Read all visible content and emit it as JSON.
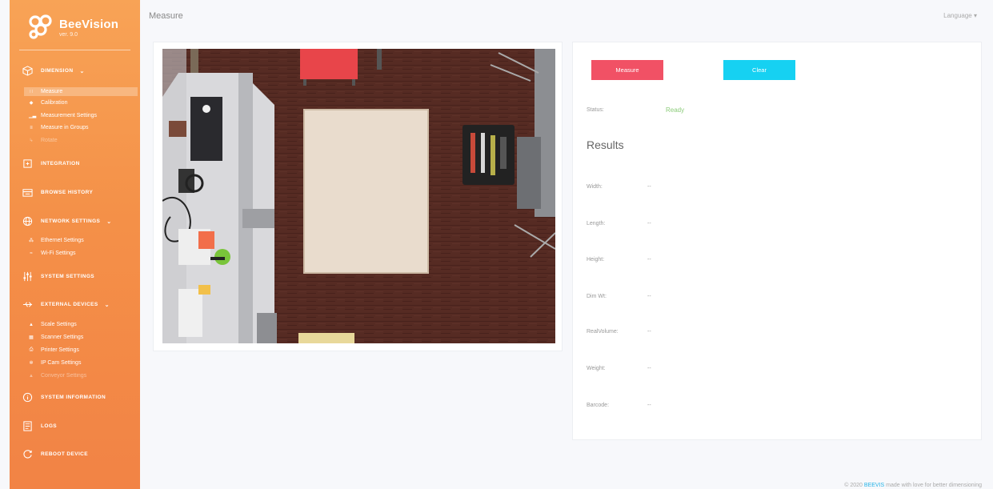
{
  "app": {
    "name": "BeeVision",
    "version": "ver. 9.0"
  },
  "sidebar": {
    "sections": [
      {
        "label": "Dimension",
        "icon": "cube-icon",
        "expanded": true,
        "items": [
          {
            "label": "Measure",
            "icon": "grid-icon",
            "active": true
          },
          {
            "label": "Calibration",
            "icon": "diamond-icon"
          },
          {
            "label": "Measurement Settings",
            "icon": "bar-chart-icon"
          },
          {
            "label": "Measure in Groups",
            "icon": "list-icon"
          },
          {
            "label": "Rotate",
            "icon": "arrow-icon",
            "disabled": true
          }
        ]
      },
      {
        "label": "Integration",
        "icon": "integration-icon"
      },
      {
        "label": "Browse History",
        "icon": "history-icon"
      },
      {
        "label": "Network Settings",
        "icon": "globe-icon",
        "expanded": true,
        "items": [
          {
            "label": "Ethernet Settings",
            "icon": "ethernet-icon"
          },
          {
            "label": "Wi-Fi Settings",
            "icon": "wifi-icon"
          }
        ]
      },
      {
        "label": "System Settings",
        "icon": "sliders-icon"
      },
      {
        "label": "External Devices",
        "icon": "usb-icon",
        "expanded": true,
        "items": [
          {
            "label": "Scale Settings",
            "icon": "scale-icon"
          },
          {
            "label": "Scanner Settings",
            "icon": "barcode-icon"
          },
          {
            "label": "Printer Settings",
            "icon": "printer-icon"
          },
          {
            "label": "IP Cam Settings",
            "icon": "camera-icon"
          },
          {
            "label": "Conveyor Settings",
            "icon": "conveyor-icon",
            "disabled": true
          }
        ]
      },
      {
        "label": "System Information",
        "icon": "info-icon"
      },
      {
        "label": "Logs",
        "icon": "log-icon"
      },
      {
        "label": "Reboot Device",
        "icon": "reboot-icon"
      }
    ]
  },
  "header": {
    "title": "Measure",
    "language_label": "Language"
  },
  "actions": {
    "measure_label": "Measure",
    "clear_label": "Clear"
  },
  "status": {
    "label": "Status:",
    "value": "Ready"
  },
  "results": {
    "heading": "Results",
    "rows": [
      {
        "label": "Width:",
        "value": "--"
      },
      {
        "label": "Length:",
        "value": "--"
      },
      {
        "label": "Height:",
        "value": "--"
      },
      {
        "label": "Dim Wt:",
        "value": "--"
      },
      {
        "label": "RealVolume:",
        "value": "--"
      },
      {
        "label": "Weight:",
        "value": "--"
      },
      {
        "label": "Barcode:",
        "value": "--"
      }
    ]
  },
  "footer": {
    "prefix": "© 2020",
    "brand": "BEEVIS",
    "suffix": "made with love for better dimensioning"
  },
  "colors": {
    "sidebar_top": "#f8a356",
    "sidebar_bottom": "#f28345",
    "measure": "#f15165",
    "clear": "#16d1f2",
    "ready": "#8ccc7a"
  }
}
